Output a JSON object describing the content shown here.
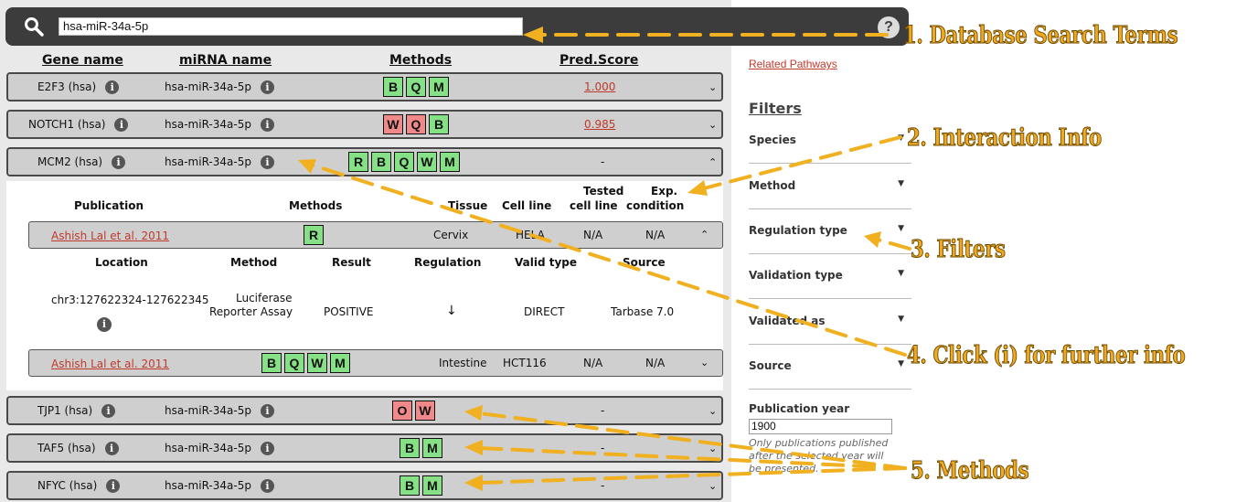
{
  "search": {
    "value": "hsa-miR-34a-5p",
    "help_label": "?"
  },
  "columns": {
    "gene": "Gene name",
    "mirna": "miRNA name",
    "methods": "Methods",
    "score": "Pred.Score"
  },
  "rows": [
    {
      "gene": "E2F3 (hsa)",
      "mirna": "hsa-miR-34a-5p",
      "methods": [
        {
          "l": "B",
          "c": "green"
        },
        {
          "l": "Q",
          "c": "green"
        },
        {
          "l": "M",
          "c": "green"
        }
      ],
      "score": "1.000",
      "chevron": "⌄"
    },
    {
      "gene": "NOTCH1 (hsa)",
      "mirna": "hsa-miR-34a-5p",
      "methods": [
        {
          "l": "W",
          "c": "red"
        },
        {
          "l": "Q",
          "c": "red"
        },
        {
          "l": "B",
          "c": "green"
        }
      ],
      "score": "0.985",
      "chevron": "⌄"
    },
    {
      "gene": "MCM2 (hsa)",
      "mirna": "hsa-miR-34a-5p",
      "methods": [
        {
          "l": "R",
          "c": "green"
        },
        {
          "l": "B",
          "c": "green"
        },
        {
          "l": "Q",
          "c": "green"
        },
        {
          "l": "W",
          "c": "green"
        },
        {
          "l": "M",
          "c": "green"
        }
      ],
      "score": "-",
      "chevron": "⌃"
    },
    {
      "gene": "TJP1 (hsa)",
      "mirna": "hsa-miR-34a-5p",
      "methods": [
        {
          "l": "O",
          "c": "red"
        },
        {
          "l": "W",
          "c": "red"
        }
      ],
      "score": "-",
      "chevron": "⌄"
    },
    {
      "gene": "TAF5 (hsa)",
      "mirna": "hsa-miR-34a-5p",
      "methods": [
        {
          "l": "B",
          "c": "green"
        },
        {
          "l": "M",
          "c": "green"
        }
      ],
      "score": "-",
      "chevron": "⌄"
    },
    {
      "gene": "NFYC (hsa)",
      "mirna": "hsa-miR-34a-5p",
      "methods": [
        {
          "l": "B",
          "c": "green"
        },
        {
          "l": "M",
          "c": "green"
        }
      ],
      "score": "-",
      "chevron": "⌄"
    }
  ],
  "expanded": {
    "headers": {
      "publication": "Publication",
      "methods": "Methods",
      "tissue": "Tissue",
      "cell_line": "Cell line",
      "tested_cell_line_1": "Tested",
      "tested_cell_line_2": "cell line",
      "exp_condition_1": "Exp.",
      "exp_condition_2": "condition"
    },
    "publications": [
      {
        "title": "Ashish Lal et al. 2011",
        "methods": [
          {
            "l": "R",
            "c": "green"
          }
        ],
        "tissue": "Cervix",
        "cell_line": "HELA",
        "tested": "N/A",
        "condition": "N/A",
        "chevron": "⌃"
      },
      {
        "title": "Ashish Lal et al. 2011",
        "methods": [
          {
            "l": "B",
            "c": "green"
          },
          {
            "l": "Q",
            "c": "green"
          },
          {
            "l": "W",
            "c": "green"
          },
          {
            "l": "M",
            "c": "green"
          }
        ],
        "tissue": "Intestine",
        "cell_line": "HCT116",
        "tested": "N/A",
        "condition": "N/A",
        "chevron": "⌄"
      }
    ],
    "detail_headers": {
      "location": "Location",
      "method": "Method",
      "result": "Result",
      "regulation": "Regulation",
      "valid_type": "Valid type",
      "source": "Source"
    },
    "detail": {
      "location": "chr3:127622324-127622345",
      "method_1": "Luciferase",
      "method_2": "Reporter Assay",
      "result": "POSITIVE",
      "regulation": "↓",
      "valid_type": "DIRECT",
      "source": "Tarbase 7.0"
    }
  },
  "sidebar": {
    "related": "Related Pathways",
    "filters_title": "Filters",
    "filters": [
      "Species",
      "Method",
      "Regulation type",
      "Validation type",
      "Validated as",
      "Source"
    ],
    "pub_year_label": "Publication year",
    "pub_year_value": "1900",
    "pub_year_note": "Only publications published after the selected year will be presented."
  },
  "annotations": {
    "a1": "1. Database Search Terms",
    "a2": "2. Interaction Info",
    "a3": "3. Filters",
    "a4": "4. Click (i) for further info",
    "a5": "5. Methods"
  },
  "colors": {
    "method_green": "#86e086",
    "method_red": "#f08a8a",
    "annotation": "#f0a820",
    "link": "#c0392b",
    "search_bar": "#3c3c3c"
  }
}
